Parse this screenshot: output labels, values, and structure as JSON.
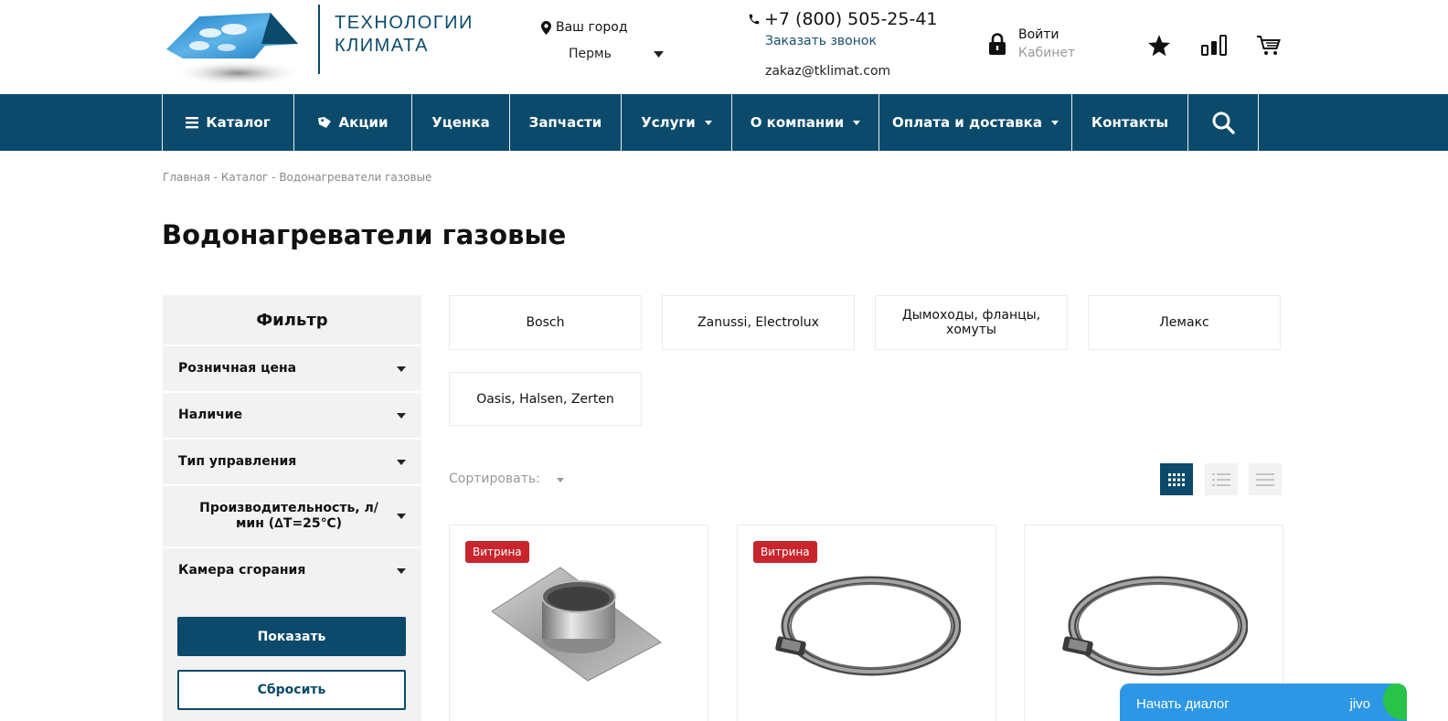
{
  "header": {
    "logo_line1": "ТЕХНОЛОГИИ",
    "logo_line2": "КЛИМАТА",
    "city_label": "Ваш город",
    "city_value": "Пермь",
    "phone": "+7 (800) 505-25-41",
    "callback_label": "Заказать звонок",
    "email": "zakaz@tklimat.com",
    "login_title": "Войти",
    "login_sub": "Кабинет"
  },
  "nav": {
    "catalog": "Каталог",
    "sales": "Акции",
    "markdown": "Уценка",
    "parts": "Запчасти",
    "services": "Услуги",
    "about": "О компании",
    "payment": "Оплата и доставка",
    "contacts": "Контакты"
  },
  "breadcrumb": {
    "home": "Главная",
    "sep": " - ",
    "catalog": "Каталог",
    "current": "Водонагреватели газовые"
  },
  "page_title": "Водонагреватели газовые",
  "filter": {
    "title": "Фильтр",
    "items": [
      "Розничная цена",
      "Наличие",
      "Тип управления",
      "Производительность, л/мин (∆T=25℃)",
      "Камера сгорания"
    ],
    "show_label": "Показать",
    "reset_label": "Сбросить"
  },
  "subcategories": [
    "Bosch",
    "Zanussi, Electrolux",
    "Дымоходы, фланцы, хомуты",
    "Лемакс",
    "Oasis, Halsen, Zerten"
  ],
  "sort": {
    "label": "Сортировать:"
  },
  "products": [
    {
      "badge": "Витрина",
      "image": "flange-image"
    },
    {
      "badge": "Витрина",
      "image": "clamp-image"
    },
    {
      "badge": "",
      "image": "clamp-image"
    }
  ],
  "chat": {
    "label": "Начать диалог",
    "brand": "jivo"
  },
  "colors": {
    "primary": "#0b4a6a",
    "badge": "#c8252c",
    "chat": "#2d97e6"
  }
}
